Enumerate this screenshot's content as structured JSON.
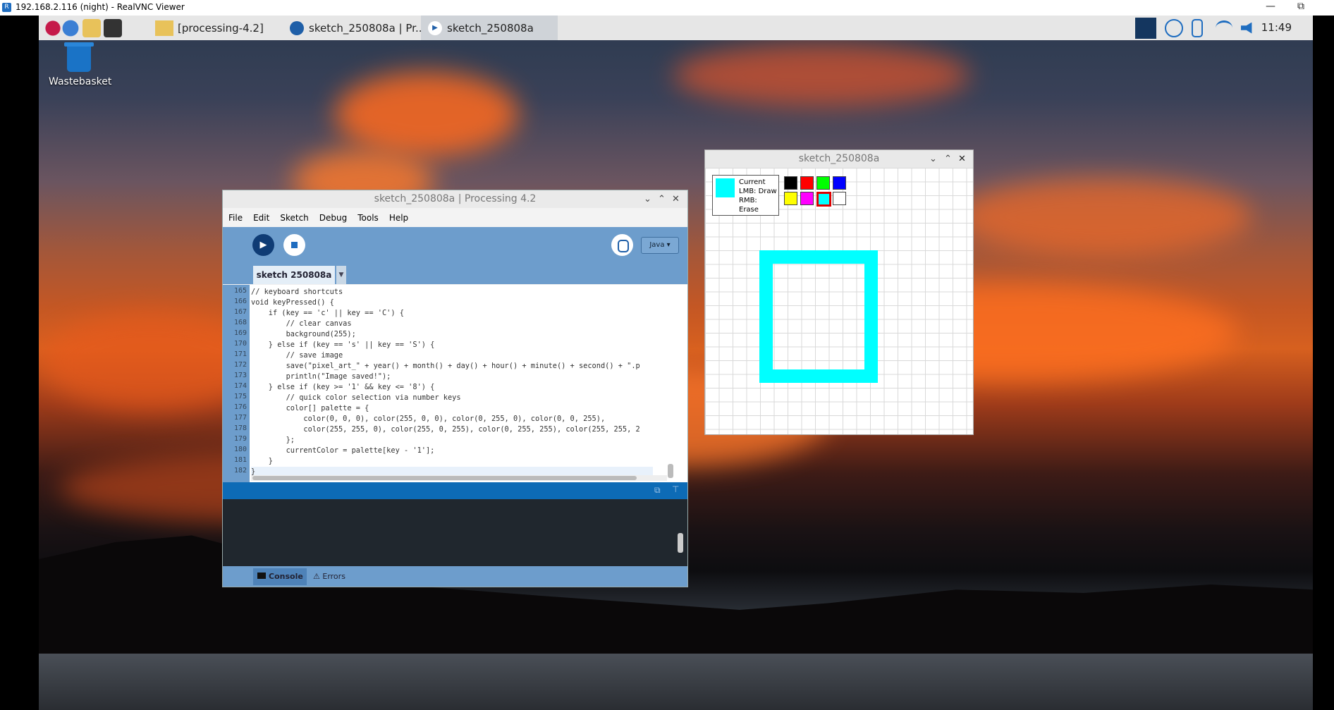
{
  "outer": {
    "title": "192.168.2.116 (night) - RealVNC Viewer",
    "logo_text": "R",
    "min": "—",
    "restore": "⧉"
  },
  "taskbar": {
    "buttons": [
      {
        "label": "[processing-4.2]"
      },
      {
        "label": "sketch_250808a | Pr..."
      },
      {
        "label": "sketch_250808a"
      }
    ],
    "clock": "11:49"
  },
  "desktop": {
    "icon_label": "Wastebasket"
  },
  "processing": {
    "title": "sketch_250808a | Processing 4.2",
    "menu": [
      "File",
      "Edit",
      "Sketch",
      "Debug",
      "Tools",
      "Help"
    ],
    "mode": "Java ▾",
    "tab": "sketch 250808a",
    "lines": [
      {
        "n": "165",
        "code": "// keyboard shortcuts"
      },
      {
        "n": "166",
        "code": "void keyPressed() {"
      },
      {
        "n": "167",
        "code": "    if (key == 'c' || key == 'C') {"
      },
      {
        "n": "168",
        "code": "        // clear canvas"
      },
      {
        "n": "169",
        "code": "        background(255);"
      },
      {
        "n": "170",
        "code": "    } else if (key == 's' || key == 'S') {"
      },
      {
        "n": "171",
        "code": "        // save image"
      },
      {
        "n": "172",
        "code": "        save(\"pixel_art_\" + year() + month() + day() + hour() + minute() + second() + \".p"
      },
      {
        "n": "173",
        "code": "        println(\"Image saved!\");"
      },
      {
        "n": "174",
        "code": "    } else if (key >= '1' && key <= '8') {"
      },
      {
        "n": "175",
        "code": "        // quick color selection via number keys"
      },
      {
        "n": "176",
        "code": "        color[] palette = {"
      },
      {
        "n": "177",
        "code": "            color(0, 0, 0), color(255, 0, 0), color(0, 255, 0), color(0, 0, 255),"
      },
      {
        "n": "178",
        "code": "            color(255, 255, 0), color(255, 0, 255), color(0, 255, 255), color(255, 255, 2"
      },
      {
        "n": "179",
        "code": "        };"
      },
      {
        "n": "180",
        "code": "        currentColor = palette[key - '1'];"
      },
      {
        "n": "181",
        "code": "    }"
      },
      {
        "n": "182",
        "code": "}"
      }
    ],
    "console_tab": "Console",
    "errors_tab": "Errors"
  },
  "sketch": {
    "title": "sketch_250808a",
    "legend": [
      "Current",
      "LMB: Draw",
      "RMB: Erase"
    ],
    "current_color": "#00ffff",
    "palette": [
      "#000000",
      "#ff0000",
      "#00ff00",
      "#0000ff",
      "#ffff00",
      "#ff00ff",
      "#00ffff",
      "#ffffff"
    ],
    "selected_index": 6
  }
}
